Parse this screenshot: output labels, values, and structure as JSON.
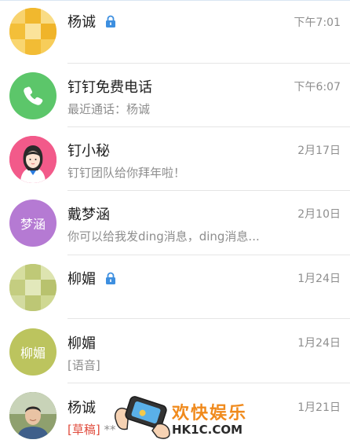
{
  "conversations": [
    {
      "name": "杨诚",
      "locked": true,
      "time": "下午7:01",
      "subtitle": "",
      "avatar_icon": "mosaic-yellow",
      "avatar_text": ""
    },
    {
      "name": "钉钉免费电话",
      "locked": false,
      "time": "下午6:07",
      "subtitle": "最近通话：杨诚",
      "avatar_icon": "phone-icon",
      "avatar_text": ""
    },
    {
      "name": "钉小秘",
      "locked": false,
      "time": "2月17日",
      "subtitle": "钉钉团队给你拜年啦！",
      "avatar_icon": "girl-avatar",
      "avatar_text": ""
    },
    {
      "name": "戴梦涵",
      "locked": false,
      "time": "2月10日",
      "subtitle": "你可以给我发ding消息，ding消息...",
      "avatar_icon": "text-avatar",
      "avatar_text": "梦涵"
    },
    {
      "name": "柳媚",
      "locked": true,
      "time": "1月24日",
      "subtitle": "",
      "avatar_icon": "mosaic-green",
      "avatar_text": ""
    },
    {
      "name": "柳媚",
      "locked": false,
      "time": "1月24日",
      "subtitle": "[语音]",
      "avatar_icon": "text-avatar",
      "avatar_text": "柳媚"
    },
    {
      "name": "杨诚",
      "locked": false,
      "time": "1月21日",
      "subtitle_tag": "[草稿]",
      "subtitle": "**",
      "avatar_icon": "photo-avatar",
      "avatar_text": ""
    }
  ],
  "watermark": {
    "title": "欢快娱乐",
    "site": "HK1C.COM"
  },
  "colors": {
    "accent": "#3d8fe0",
    "draft": "#e04b3c",
    "yellow": "#f6c443",
    "green": "#5cc66a",
    "pink": "#f25a8a",
    "purple": "#b57ad3",
    "olive": "#bcc45e"
  }
}
